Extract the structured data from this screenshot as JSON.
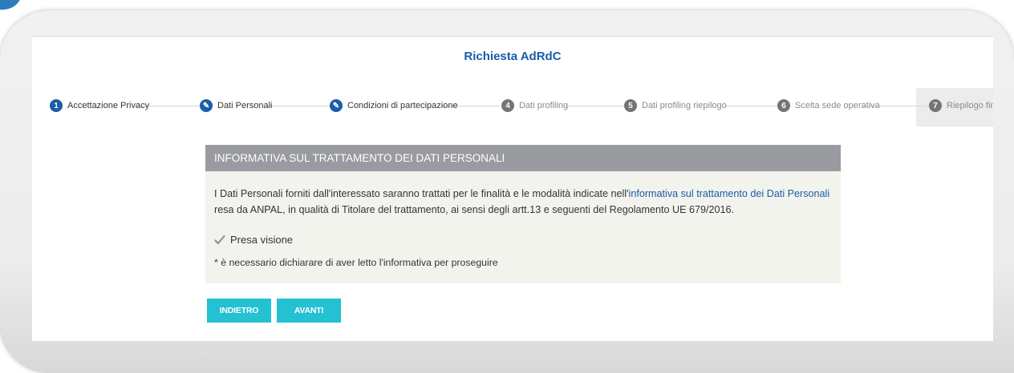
{
  "page": {
    "title": "Richiesta AdRdC",
    "steps": [
      {
        "num": "1",
        "label": "Accettazione Privacy"
      },
      {
        "num": "✎",
        "label": "Dati Personali"
      },
      {
        "num": "✎",
        "label": "Condizioni di partecipazione"
      },
      {
        "num": "4",
        "label": "Dati profiling"
      },
      {
        "num": "5",
        "label": "Dati profiling riepilogo"
      },
      {
        "num": "6",
        "label": "Scelta sede operativa"
      },
      {
        "num": "7",
        "label": "Riepilogo finale"
      }
    ]
  },
  "panel": {
    "heading": "INFORMATIVA SUL TRATTAMENTO DEI DATI PERSONALI",
    "text_before": "I Dati Personali forniti dall'interessato saranno trattati per le finalità e le modalità indicate nell'",
    "link": "informativa sul trattamento dei Dati Personali",
    "text_after": " resa da ANPAL, in qualità di Titolare del trattamento, ai sensi degli artt.13 e seguenti del Regolamento UE 679/2016.",
    "checkbox_label": "Presa visione",
    "checkbox_checked": true,
    "note": "* è necessario dichiarare di aver letto l'informativa per proseguire"
  },
  "buttons": {
    "back": "INDIETRO",
    "next": "AVANTI"
  },
  "colors": {
    "accent": "#1a5da8",
    "button": "#23c1d1",
    "panel_header": "#999ba0"
  }
}
